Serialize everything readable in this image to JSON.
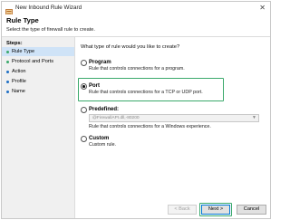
{
  "window": {
    "title": "New Inbound Rule Wizard",
    "close_glyph": "✕"
  },
  "header": {
    "title": "Rule Type",
    "subtitle": "Select the type of firewall rule to create."
  },
  "steps": {
    "heading": "Steps:",
    "items": [
      {
        "label": "Rule Type",
        "current": true,
        "bullet_color": "#3aa96b"
      },
      {
        "label": "Protocol and Ports",
        "current": false,
        "bullet_color": "#3aa96b"
      },
      {
        "label": "Action",
        "current": false,
        "bullet_color": "#1e6fc4"
      },
      {
        "label": "Profile",
        "current": false,
        "bullet_color": "#1e6fc4"
      },
      {
        "label": "Name",
        "current": false,
        "bullet_color": "#1e6fc4"
      }
    ]
  },
  "main": {
    "question": "What type of rule would you like to create?",
    "options": [
      {
        "label": "Program",
        "description": "Rule that controls connections for a program.",
        "checked": false
      },
      {
        "label": "Port",
        "description": "Rule that controls connections for a TCP or UDP port.",
        "checked": true
      },
      {
        "label": "Predefined:",
        "description": "Rule that controls connections for a Windows experience.",
        "checked": false,
        "select_value": "@FirewallAPI.dll,-80200"
      },
      {
        "label": "Custom",
        "description": "Custom rule.",
        "checked": false
      }
    ]
  },
  "footer": {
    "back_label": "< Back",
    "next_label": "Next >",
    "cancel_label": "Cancel"
  },
  "colors": {
    "highlight": "#3aa96b",
    "current_step_bg": "#cfe3f7",
    "default_button_border": "#0078d7"
  },
  "icons": {
    "title": "firewall-wizard-icon",
    "close": "close-icon",
    "dropdown": "chevron-down-icon"
  }
}
